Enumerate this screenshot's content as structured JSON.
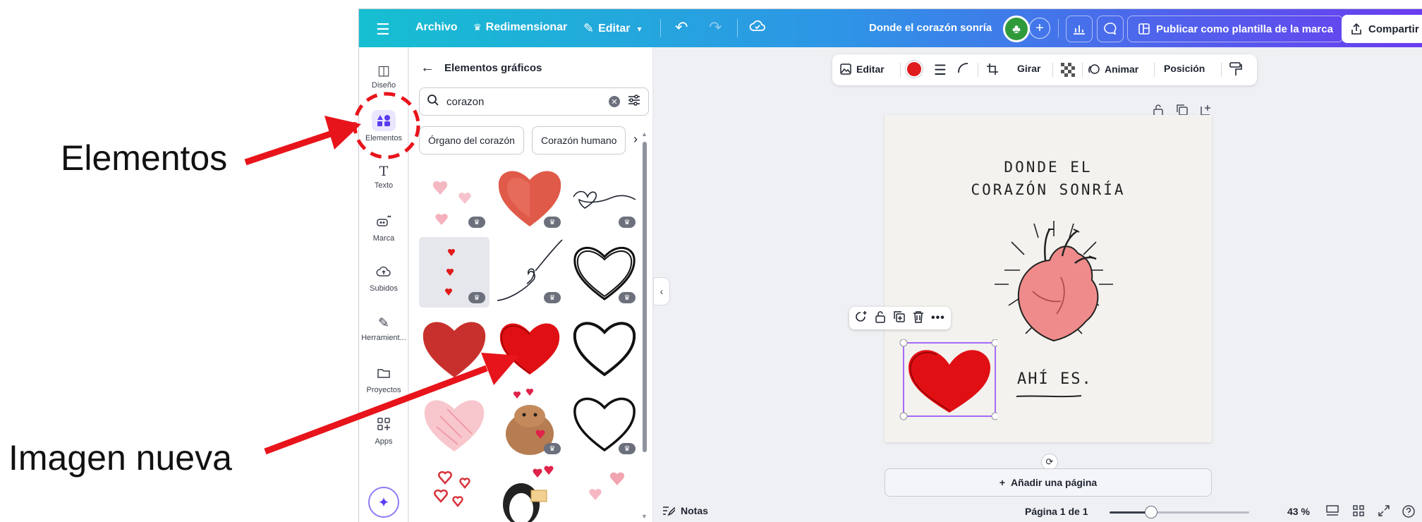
{
  "annotations": {
    "elementos_label": "Elementos",
    "imagen_label": "Imagen nueva",
    "arrow_color": "#e8141b"
  },
  "topbar": {
    "menu_icon": "hamburger-icon",
    "archivo": "Archivo",
    "redimensionar": "Redimensionar",
    "editar": "Editar",
    "doc_title": "Donde el corazón sonría",
    "publish": "Publicar como plantilla de la marca",
    "share": "Compartir",
    "gradient": [
      "#16bfd1",
      "#2e95e6",
      "#6a3cf0"
    ]
  },
  "rail": {
    "items": [
      {
        "label": "Diseño",
        "icon": "layout-icon"
      },
      {
        "label": "Elementos",
        "icon": "shapes-icon"
      },
      {
        "label": "Texto",
        "icon": "text-icon"
      },
      {
        "label": "Marca",
        "icon": "brand-icon"
      },
      {
        "label": "Subidos",
        "icon": "cloud-upload-icon"
      },
      {
        "label": "Herramient...",
        "icon": "pen-tool-icon"
      },
      {
        "label": "Proyectos",
        "icon": "folder-icon"
      },
      {
        "label": "Apps",
        "icon": "apps-icon"
      }
    ],
    "active": "Elementos",
    "accent": "#5b3cf0"
  },
  "panel": {
    "title": "Elementos gráficos",
    "search": {
      "value": "corazon"
    },
    "chips": [
      "Órgano del corazón",
      "Corazón humano"
    ]
  },
  "context_toolbar": {
    "editar": "Editar",
    "girar": "Girar",
    "animar": "Animar",
    "posicion": "Posición",
    "selected_color": "#e01b1b"
  },
  "page": {
    "title_line1": "DONDE EL",
    "title_line2": "CORAZÓN SONRÍA",
    "subtitle": "AHÍ ES."
  },
  "canvas": {
    "add_page": "Añadir una página"
  },
  "bottom": {
    "notes": "Notas",
    "page_info": "Página 1 de 1",
    "zoom_label": "43 %",
    "zoom_fraction": 0.3
  }
}
